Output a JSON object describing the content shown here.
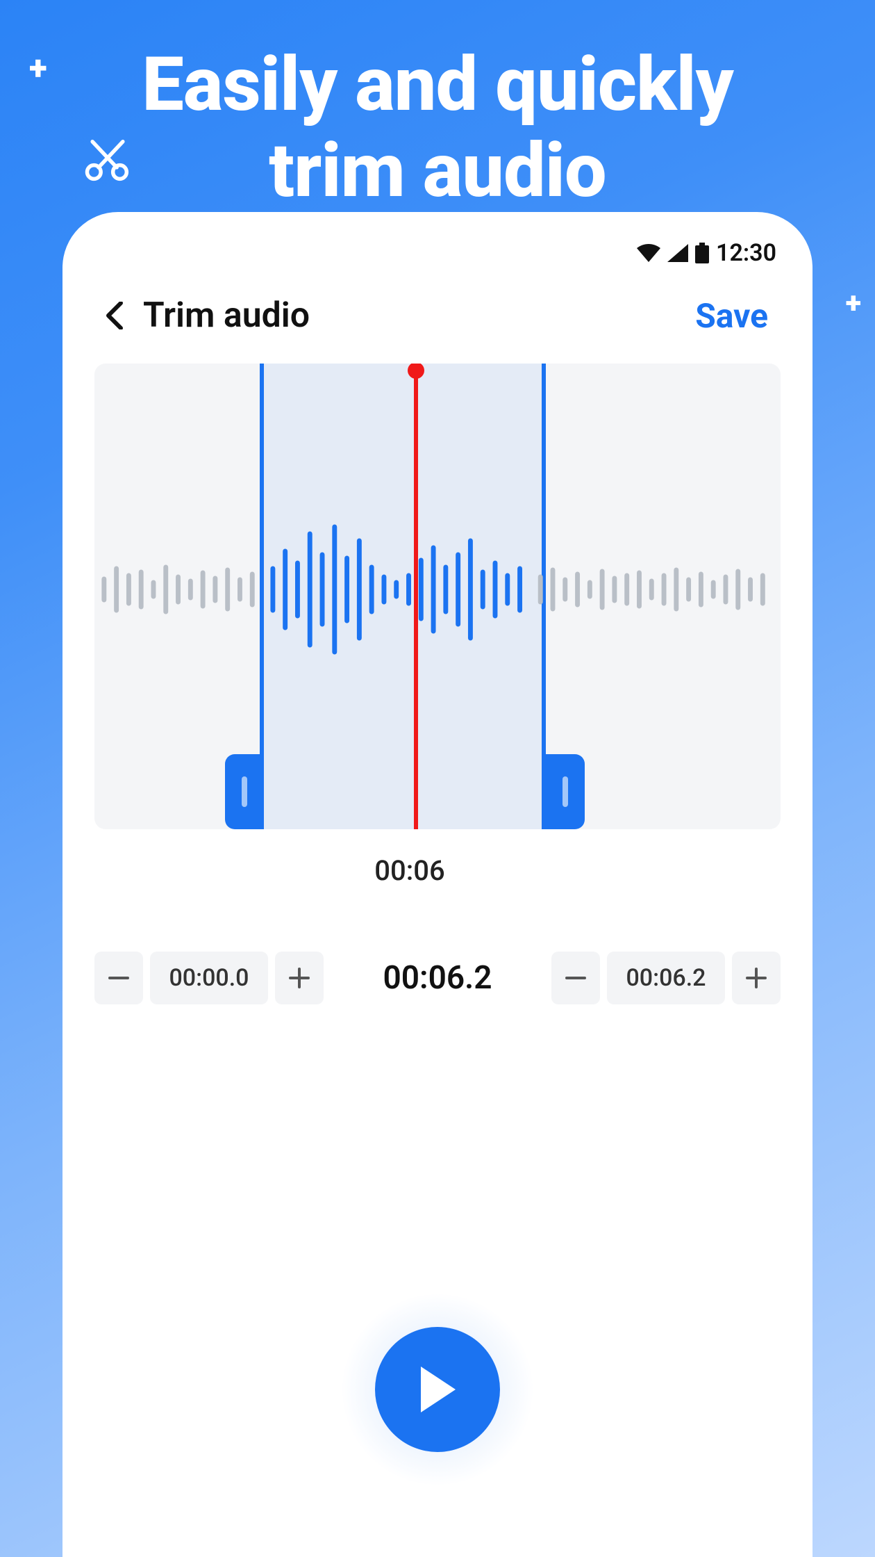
{
  "hero": {
    "title_line1": "Easily and quickly",
    "title_line2": "trim audio"
  },
  "statusbar": {
    "time": "12:30"
  },
  "header": {
    "title": "Trim audio",
    "save_label": "Save"
  },
  "playhead": {
    "time_label": "00:06"
  },
  "trim": {
    "start": {
      "value": "00:00.0"
    },
    "current": {
      "value": "00:06.2"
    },
    "end": {
      "value": "00:06.2"
    }
  },
  "colors": {
    "accent": "#1b73f1",
    "danger": "#f01919"
  }
}
